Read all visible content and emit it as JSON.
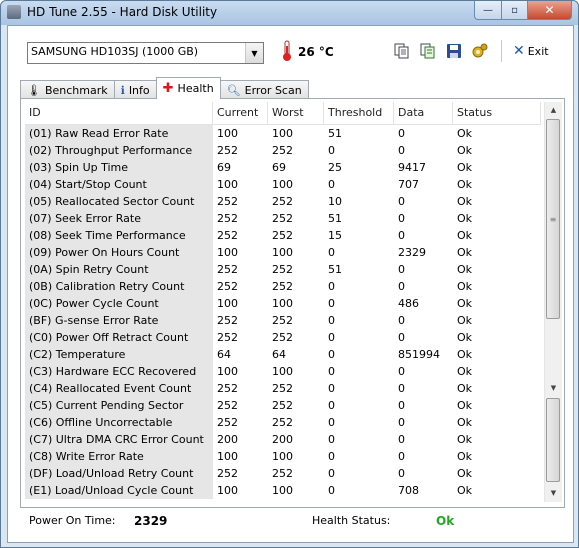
{
  "window": {
    "title": "HD Tune 2.55 - Hard Disk Utility",
    "controls": {
      "minimize": "—",
      "maximize": "▫",
      "close": "✕"
    }
  },
  "toolbar": {
    "drive_selected": "SAMSUNG HD103SJ (1000 GB)",
    "temperature": "26 °C",
    "exit_label": "Exit"
  },
  "tabs": [
    {
      "label": "Benchmark",
      "icon": "benchmark-icon"
    },
    {
      "label": "Info",
      "icon": "info-icon"
    },
    {
      "label": "Health",
      "icon": "health-cross-icon",
      "active": true
    },
    {
      "label": "Error Scan",
      "icon": "magnifier-icon"
    }
  ],
  "table": {
    "columns": [
      "ID",
      "Current",
      "Worst",
      "Threshold",
      "Data",
      "Status"
    ],
    "rows": [
      [
        "(01) Raw Read Error Rate",
        "100",
        "100",
        "51",
        "0",
        "Ok"
      ],
      [
        "(02) Throughput Performance",
        "252",
        "252",
        "0",
        "0",
        "Ok"
      ],
      [
        "(03) Spin Up Time",
        "69",
        "69",
        "25",
        "9417",
        "Ok"
      ],
      [
        "(04) Start/Stop Count",
        "100",
        "100",
        "0",
        "707",
        "Ok"
      ],
      [
        "(05) Reallocated Sector Count",
        "252",
        "252",
        "10",
        "0",
        "Ok"
      ],
      [
        "(07) Seek Error Rate",
        "252",
        "252",
        "51",
        "0",
        "Ok"
      ],
      [
        "(08) Seek Time Performance",
        "252",
        "252",
        "15",
        "0",
        "Ok"
      ],
      [
        "(09) Power On Hours Count",
        "100",
        "100",
        "0",
        "2329",
        "Ok"
      ],
      [
        "(0A) Spin Retry Count",
        "252",
        "252",
        "51",
        "0",
        "Ok"
      ],
      [
        "(0B) Calibration Retry Count",
        "252",
        "252",
        "0",
        "0",
        "Ok"
      ],
      [
        "(0C) Power Cycle Count",
        "100",
        "100",
        "0",
        "486",
        "Ok"
      ],
      [
        "(BF) G-sense Error Rate",
        "252",
        "252",
        "0",
        "0",
        "Ok"
      ],
      [
        "(C0) Power Off Retract Count",
        "252",
        "252",
        "0",
        "0",
        "Ok"
      ],
      [
        "(C2) Temperature",
        "64",
        "64",
        "0",
        "851994",
        "Ok"
      ],
      [
        "(C3) Hardware ECC Recovered",
        "100",
        "100",
        "0",
        "0",
        "Ok"
      ],
      [
        "(C4) Reallocated Event Count",
        "252",
        "252",
        "0",
        "0",
        "Ok"
      ],
      [
        "(C5) Current Pending Sector",
        "252",
        "252",
        "0",
        "0",
        "Ok"
      ],
      [
        "(C6) Offline Uncorrectable",
        "252",
        "252",
        "0",
        "0",
        "Ok"
      ],
      [
        "(C7) Ultra DMA CRC Error Count",
        "200",
        "200",
        "0",
        "0",
        "Ok"
      ],
      [
        "(C8) Write Error Rate",
        "100",
        "100",
        "0",
        "0",
        "Ok"
      ],
      [
        "(DF) Load/Unload Retry Count",
        "252",
        "252",
        "0",
        "0",
        "Ok"
      ],
      [
        "(E1) Load/Unload Cycle Count",
        "100",
        "100",
        "0",
        "708",
        "Ok"
      ]
    ]
  },
  "status_bar": {
    "power_on_label": "Power On Time:",
    "power_on_value": "2329",
    "health_label": "Health Status:",
    "health_value": "Ok",
    "health_color": "#22aa22"
  }
}
